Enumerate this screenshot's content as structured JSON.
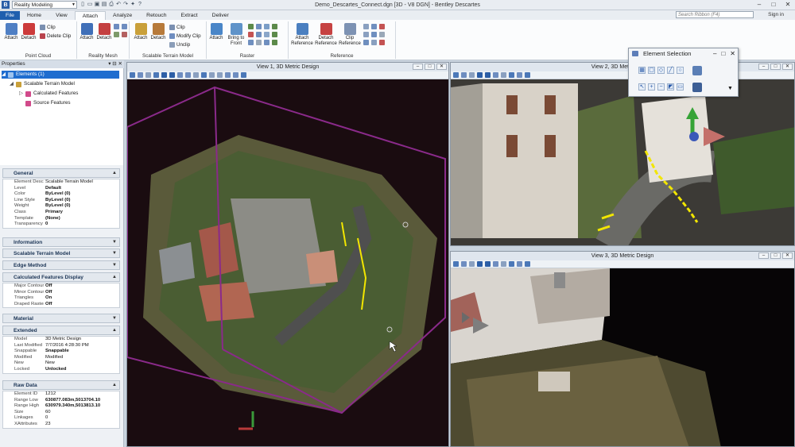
{
  "titlebar": {
    "workflow": "Reality Modeling",
    "document_title": "Demo_Descartes_Connect.dgn [3D - V8 DGN] - Bentley Descartes",
    "minimize": "–",
    "maximize": "□",
    "close": "✕"
  },
  "tabs": [
    "File",
    "Home",
    "View",
    "Attach",
    "Analyze",
    "Retouch",
    "Extract",
    "Deliver"
  ],
  "search": {
    "placeholder": "Search Ribbon (F4)"
  },
  "signin": "Sign in",
  "ribbon": {
    "point_cloud": {
      "label": "Point Cloud",
      "attach": "Attach",
      "detach": "Detach",
      "clip": "Clip",
      "delete_clip": "Delete Clip"
    },
    "reality_mesh": {
      "label": "Reality Mesh",
      "attach": "Attach",
      "detach": "Detach"
    },
    "terrain": {
      "label": "Scalable Terrain Model",
      "attach": "Attach",
      "detach": "Detach",
      "clip": "Clip",
      "modify_clip": "Modify Clip",
      "unclip": "Unclip"
    },
    "raster": {
      "label": "Raster",
      "attach": "Attach",
      "bring_to_front": "Bring to Front"
    },
    "reference": {
      "label": "Reference",
      "attach": "Attach Reference",
      "detach": "Detach Reference",
      "clip": "Clip Reference"
    }
  },
  "properties": {
    "panel_title": "Properties",
    "tree": {
      "root": "Elements (1)",
      "stm": "Scalable Terrain Model",
      "calculated": "Calculated Features",
      "source": "Source Features"
    },
    "general": {
      "title": "General",
      "rows": [
        [
          "Element Descripti",
          "Scalable Terrain Model"
        ],
        [
          "Level",
          "Default"
        ],
        [
          "Color",
          "ByLevel (0)"
        ],
        [
          "Line Style",
          "ByLevel (0)"
        ],
        [
          "Weight",
          "ByLevel (0)"
        ],
        [
          "Class",
          "Primary"
        ],
        [
          "Template",
          "(None)"
        ],
        [
          "Transparency",
          "0"
        ]
      ]
    },
    "information": "Information",
    "stm_section": "Scalable Terrain Model",
    "edge_method": "Edge Method",
    "calc_display": {
      "title": "Calculated Features Display",
      "rows": [
        [
          "Major Contours",
          "Off"
        ],
        [
          "Minor Contours",
          "Off"
        ],
        [
          "Triangles",
          "On"
        ],
        [
          "Draped Rasters",
          "Off"
        ]
      ]
    },
    "material": "Material",
    "extended": {
      "title": "Extended",
      "rows": [
        [
          "Model",
          "3D Metric Design"
        ],
        [
          "Last Modified",
          "7/7/2016 4:28:30 PM"
        ],
        [
          "Snappable",
          "Snappable"
        ],
        [
          "Modified",
          "Modified"
        ],
        [
          "New",
          "New"
        ],
        [
          "Locked",
          "Unlocked"
        ]
      ]
    },
    "raw_data": {
      "title": "Raw Data",
      "rows": [
        [
          "Element ID",
          "1212"
        ],
        [
          "Range Low",
          "630877.083m,5013704.10"
        ],
        [
          "Range High",
          "630979.340m,5013813.10"
        ],
        [
          "Size",
          "60"
        ],
        [
          "Linkages",
          "0"
        ],
        [
          "XAttributes",
          "23"
        ]
      ]
    }
  },
  "views": {
    "view1": "View 1, 3D Metric Design",
    "view2": "View 2, 3D Metric Design",
    "view3": "View 3, 3D Metric Design"
  },
  "element_selection": {
    "title": "Element Selection"
  },
  "colors": {
    "accent": "#1f5fae",
    "selection": "#1f6dcf",
    "view_background": "#1a0c10",
    "clip_box": "#8a2a8a",
    "breakline": "#f2e600"
  }
}
